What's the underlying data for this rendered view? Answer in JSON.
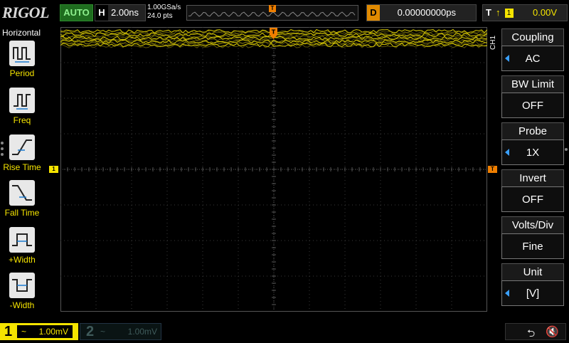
{
  "topbar": {
    "logo": "RIGOL",
    "run_mode": "AUTO",
    "horizontal_letter": "H",
    "timebase": "2.00ns",
    "sample_rate": "1.00GSa/s",
    "memory_depth": "24.0 pts",
    "trigger_marker": "T",
    "delay_letter": "D",
    "delay_value": "0.00000000ps",
    "trigger_letter": "T",
    "trigger_source": "1",
    "trigger_level": "0.00V"
  },
  "left_menu": {
    "title": "Horizontal",
    "items": [
      {
        "label": "Period",
        "icon": "period-icon"
      },
      {
        "label": "Freq",
        "icon": "frequency-icon"
      },
      {
        "label": "Rise Time",
        "icon": "rise-time-icon"
      },
      {
        "label": "Fall Time",
        "icon": "fall-time-icon"
      },
      {
        "label": "+Width",
        "icon": "positive-width-icon"
      },
      {
        "label": "-Width",
        "icon": "negative-width-icon"
      }
    ]
  },
  "right_menu": {
    "channel_label": "CH1",
    "buttons": [
      {
        "title": "Coupling",
        "value": "AC",
        "has_arrow": true
      },
      {
        "title": "BW Limit",
        "value": "OFF",
        "has_arrow": false
      },
      {
        "title": "Probe",
        "value": "1X",
        "has_arrow": true
      },
      {
        "title": "Invert",
        "value": "OFF",
        "has_arrow": false
      },
      {
        "title": "Volts/Div",
        "value": "Fine",
        "has_arrow": false
      },
      {
        "title": "Unit",
        "value": "[V]",
        "has_arrow": true
      }
    ]
  },
  "markers": {
    "ch1_marker": "1",
    "trigger_level_marker": "T",
    "trigger_position_marker": "T"
  },
  "bottombar": {
    "ch1": {
      "number": "1",
      "coupling": "~",
      "scale": "1.00mV"
    },
    "ch2": {
      "number": "2",
      "coupling": "~",
      "scale": "1.00mV"
    }
  },
  "colors": {
    "ch1": "#f5e400",
    "trigger": "#f07f00",
    "accent": "#3aa0ff"
  }
}
